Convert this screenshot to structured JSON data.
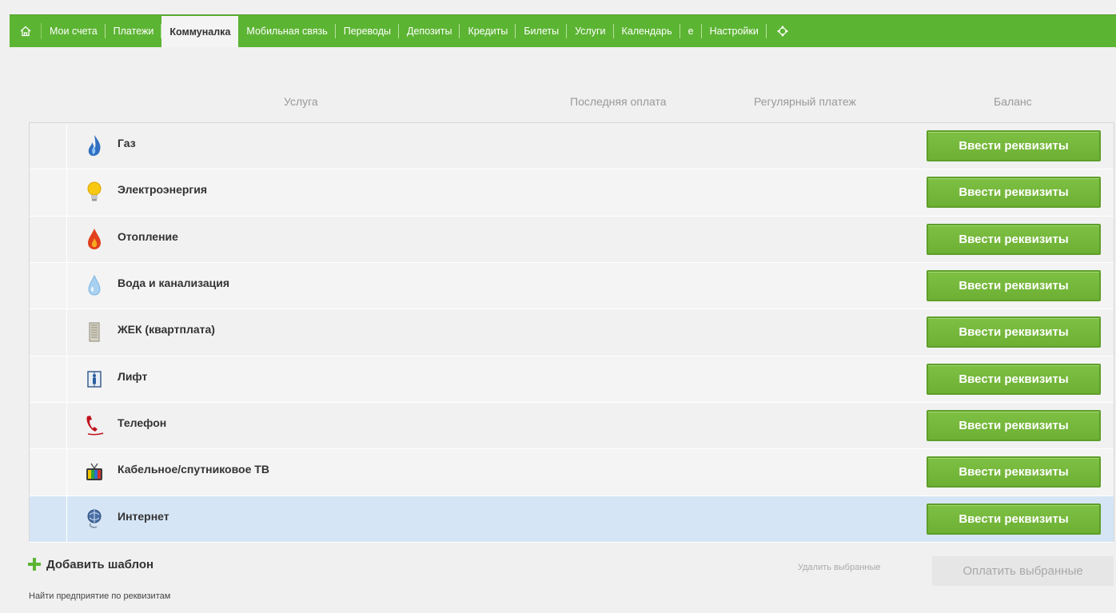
{
  "nav": {
    "tabs": [
      {
        "label": "Мои счета"
      },
      {
        "label": "Платежи"
      },
      {
        "label": "Коммуналка"
      },
      {
        "label": "Мобильная связь"
      },
      {
        "label": "Переводы"
      },
      {
        "label": "Депозиты"
      },
      {
        "label": "Кредиты"
      },
      {
        "label": "Билеты"
      },
      {
        "label": "Услуги"
      },
      {
        "label": "Календарь"
      },
      {
        "label": "e"
      },
      {
        "label": "Настройки"
      }
    ],
    "active_tab": "Коммуналка"
  },
  "table": {
    "headers": {
      "service": "Услуга",
      "last_payment": "Последняя оплата",
      "regular_payment": "Регулярный платеж",
      "balance": "Баланс"
    },
    "button_label": "Ввести реквизиты",
    "rows": [
      {
        "name": "Газ",
        "icon": "gas-flame-icon"
      },
      {
        "name": "Электроэнергия",
        "icon": "lightbulb-icon"
      },
      {
        "name": "Отопление",
        "icon": "heating-drop-icon"
      },
      {
        "name": "Вода и канализация",
        "icon": "water-drop-icon"
      },
      {
        "name": "ЖЕК (квартплата)",
        "icon": "building-icon"
      },
      {
        "name": "Лифт",
        "icon": "elevator-icon"
      },
      {
        "name": "Телефон",
        "icon": "phone-icon"
      },
      {
        "name": "Кабельное/спутниковое ТВ",
        "icon": "tv-icon"
      },
      {
        "name": "Интернет",
        "icon": "internet-icon"
      }
    ]
  },
  "footer": {
    "add_template": "Добавить шаблон",
    "find_company": "Найти предприятие по реквизитам",
    "delete_selected": "Удалить выбранные",
    "pay_selected": "Оплатить выбранные"
  },
  "colors": {
    "nav_green": "#5cb433",
    "button_green": "#72b43a",
    "selected_row": "#d5e5f5"
  }
}
